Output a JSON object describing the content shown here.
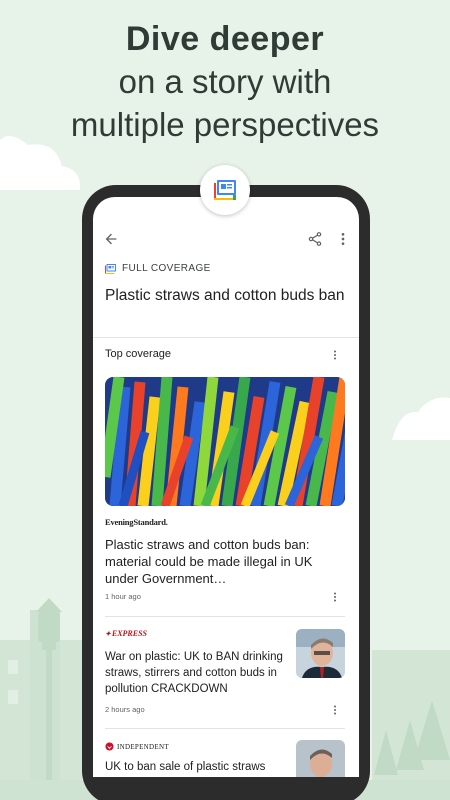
{
  "headline": {
    "line1": "Dive deeper",
    "line2": "on a story with",
    "line3": "multiple perspectives"
  },
  "colors": {
    "background": "#e7f3e9",
    "accent_blue": "#4285f4",
    "accent_red": "#ea4335",
    "accent_yellow": "#fbbc04",
    "accent_green": "#34a853"
  },
  "app": {
    "icons": {
      "badge": "full-coverage-icon",
      "back": "back-arrow-icon",
      "share": "share-icon",
      "more": "more-vert-icon"
    },
    "full_coverage_label": "FULL COVERAGE",
    "story_title": "Plastic straws and cotton buds ban",
    "section_title": "Top coverage",
    "articles": [
      {
        "source": "EveningStandard.",
        "title": "Plastic straws and cotton buds ban: material could be made illegal in UK under Government…",
        "time": "1 hour ago"
      },
      {
        "source": "EXPRESS",
        "title": "War on plastic: UK to BAN drinking straws, stirrers and cotton buds in pollution CRACKDOWN",
        "time": "2 hours ago"
      },
      {
        "source": "INDEPENDENT",
        "title": "UK to ban sale of plastic straws"
      }
    ]
  }
}
